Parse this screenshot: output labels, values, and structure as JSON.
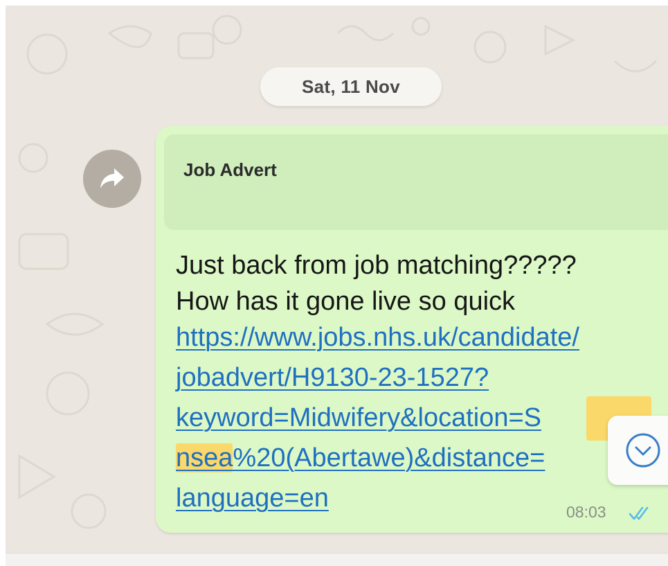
{
  "chat": {
    "date_label": "Sat, 11 Nov"
  },
  "message": {
    "quote_author": "Job Advert",
    "text_lines": [
      "Just back from job matching?????",
      "How has it gone live so quick"
    ],
    "link_lines": [
      "https://www.jobs.nhs.uk/candidate/",
      "jobadvert/H9130-23-1527?",
      "keyword=Midwifery&location=S",
      "nsea",
      "%20(Abertawe)&distance=",
      "language=en"
    ],
    "time": "08:03",
    "status": "read",
    "highlight_color": "#fad86a",
    "link_color": "#1f70c1"
  },
  "icons": {
    "forward": "forward-arrow-icon",
    "scroll_down": "chevron-down-circle-icon",
    "read_ticks": "double-check-icon"
  },
  "colors": {
    "bubble": "#dcf8c6",
    "quote_block": "#cfeebc",
    "chat_background": "#ebe6df",
    "tick_blue": "#53bdeb"
  }
}
